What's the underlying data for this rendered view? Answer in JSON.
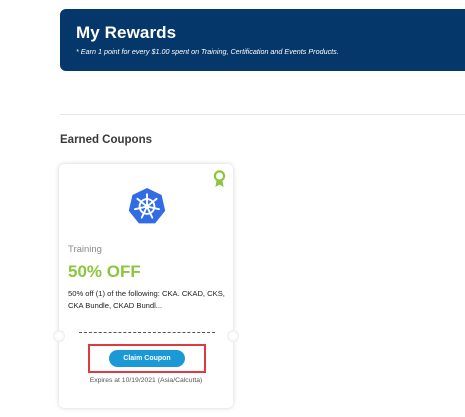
{
  "rewards": {
    "title": "My Rewards",
    "subtitle": "* Earn 1 point for every $1.00 spent on Training, Certification and Events Products."
  },
  "section": {
    "title": "Earned Coupons"
  },
  "coupon": {
    "category": "Training",
    "discount": "50% OFF",
    "description": "50% off (1) of the following: CKA. CKAD, CKS, CKA Bundle, CKAD Bundl...",
    "claim_label": "Claim Coupon",
    "expiry": "Expires at 10/19/2021 (Asia/Calcutta)",
    "logo_icon": "kubernetes-logo-icon",
    "badge_icon": "award-ribbon-icon"
  },
  "colors": {
    "banner_bg": "#06376a",
    "discount_green": "#8cc63f",
    "button_blue": "#1a99d6",
    "highlight_red": "#e03a3e"
  }
}
